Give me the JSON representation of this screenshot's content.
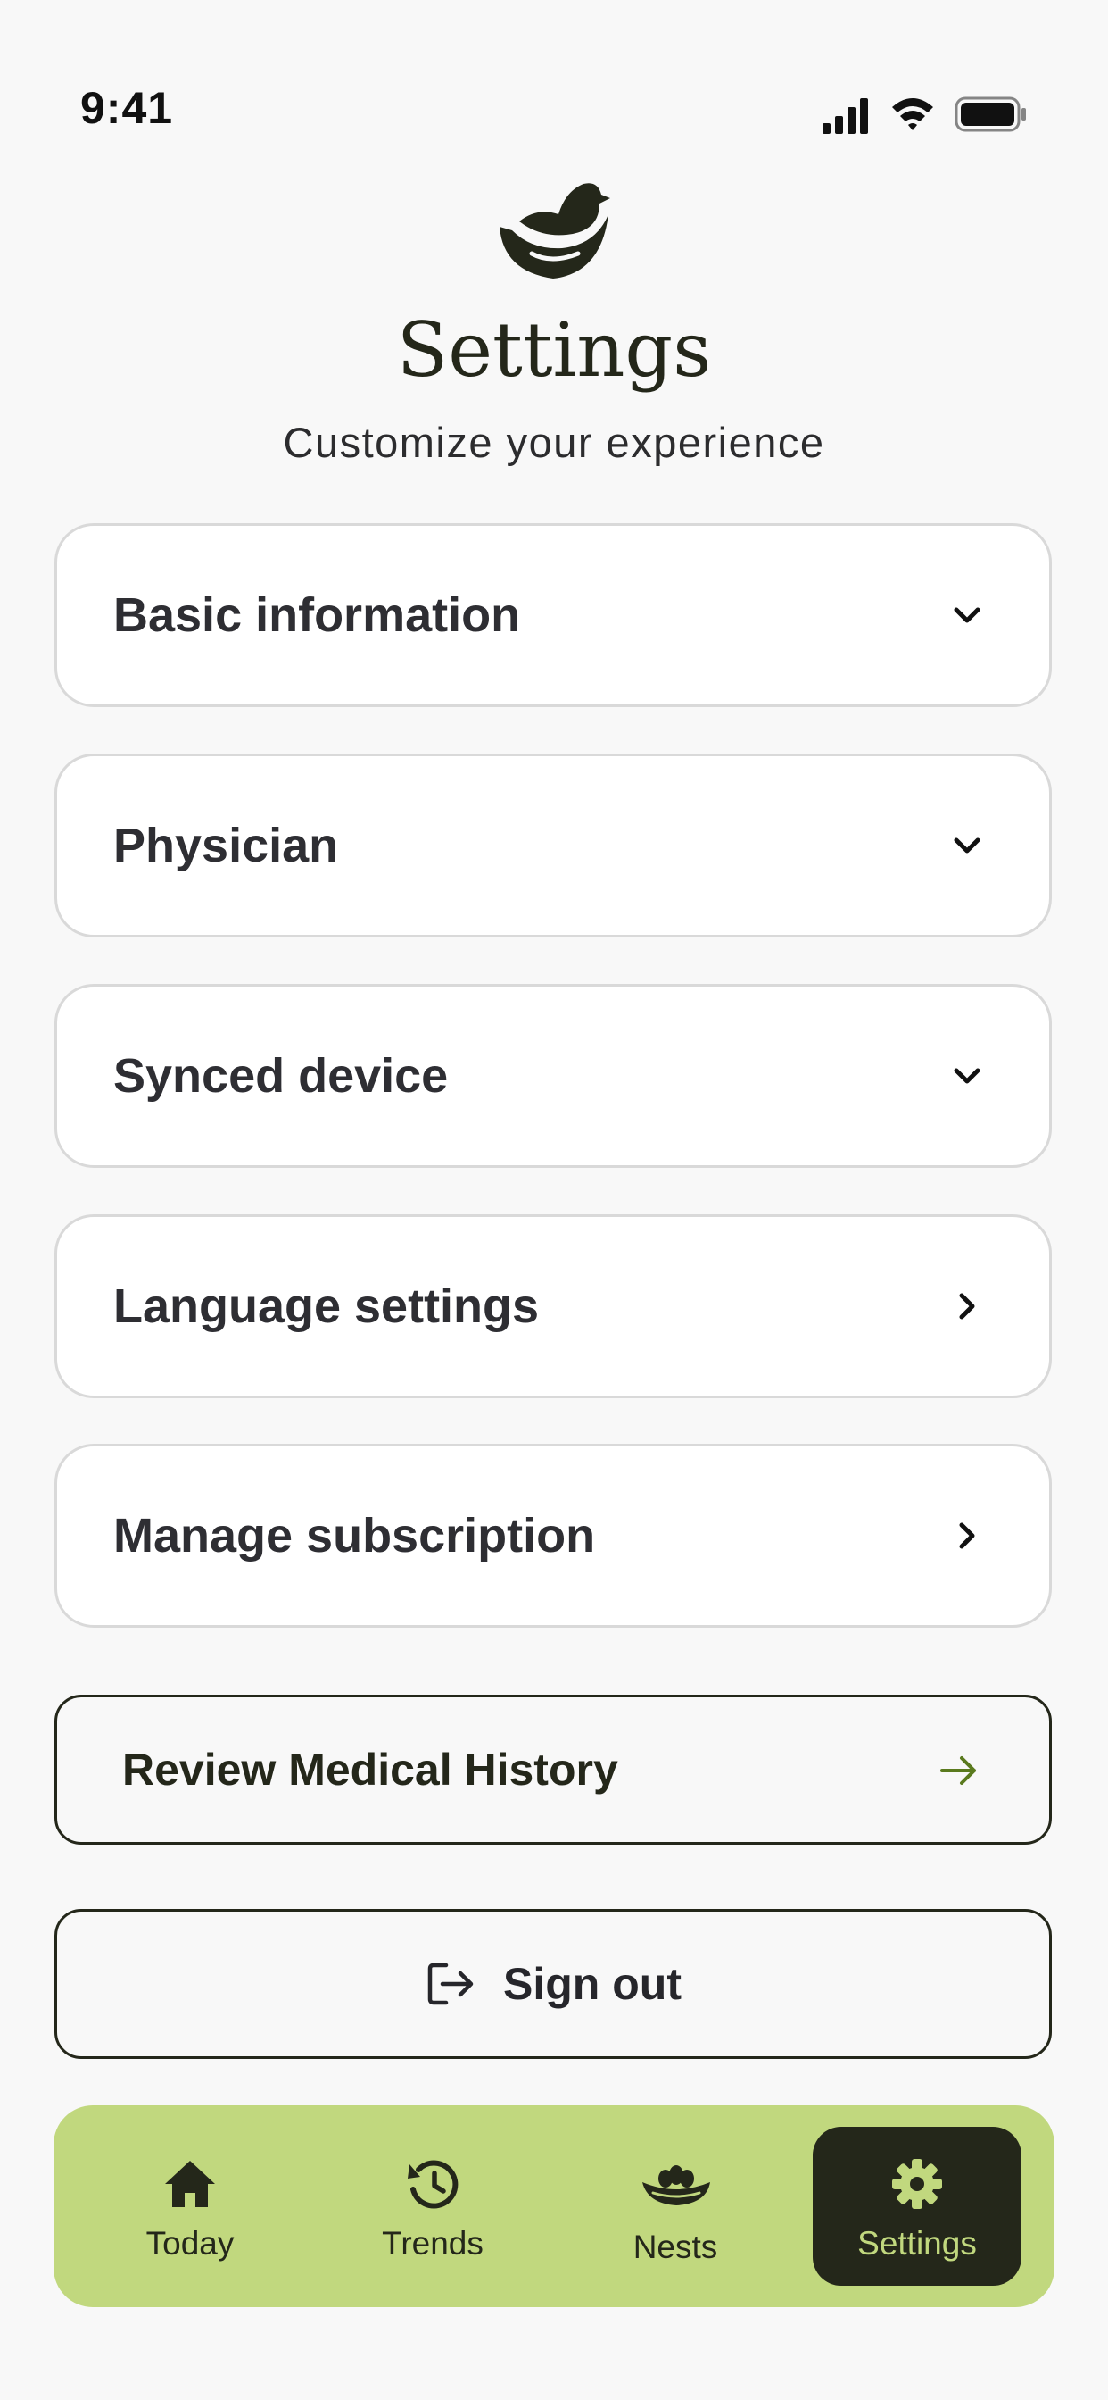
{
  "status_bar": {
    "time": "9:41",
    "icons": [
      "cellular-signal-icon",
      "wifi-icon",
      "battery-icon"
    ]
  },
  "header": {
    "logo_icon": "bird-nest-logo-icon",
    "title": "Settings",
    "subtitle": "Customize your experience"
  },
  "settings_items": [
    {
      "label": "Basic information",
      "icon": "chevron-down-icon"
    },
    {
      "label": "Physician",
      "icon": "chevron-down-icon"
    },
    {
      "label": "Synced device",
      "icon": "chevron-down-icon"
    },
    {
      "label": "Language settings",
      "icon": "chevron-right-icon"
    },
    {
      "label": "Manage subscription",
      "icon": "chevron-right-icon"
    }
  ],
  "review_button": {
    "label": "Review Medical History",
    "icon": "arrow-right-icon"
  },
  "signout_button": {
    "label": "Sign out",
    "icon": "sign-out-icon"
  },
  "tabbar": {
    "active": "Settings",
    "tabs": [
      {
        "label": "Today",
        "icon": "home-icon"
      },
      {
        "label": "Trends",
        "icon": "history-icon"
      },
      {
        "label": "Nests",
        "icon": "nest-icon"
      },
      {
        "label": "Settings",
        "icon": "gear-icon"
      }
    ]
  },
  "colors": {
    "background": "#f8f8f8",
    "primary_dark": "#24271a",
    "accent_green": "#c1d87e",
    "card_border": "#d9d9d9",
    "review_arrow": "#5a7a1e"
  }
}
